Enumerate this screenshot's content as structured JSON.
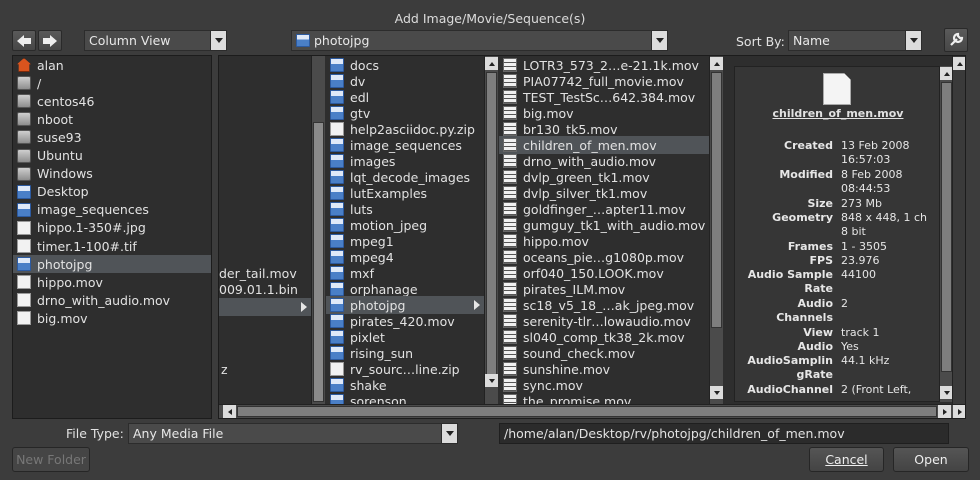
{
  "dialog": {
    "title": "Add Image/Movie/Sequence(s)"
  },
  "toolbar": {
    "view_mode": "Column View",
    "location": "photojpg",
    "sort_label": "Sort By:",
    "sort_value": "Name"
  },
  "places": [
    {
      "label": "alan",
      "icon": "home-icon"
    },
    {
      "label": "/",
      "icon": "drive-icon"
    },
    {
      "label": "centos46",
      "icon": "drive-icon"
    },
    {
      "label": "nboot",
      "icon": "drive-icon"
    },
    {
      "label": "suse93",
      "icon": "drive-icon"
    },
    {
      "label": "Ubuntu",
      "icon": "drive-icon"
    },
    {
      "label": "Windows",
      "icon": "drive-icon"
    },
    {
      "label": "Desktop",
      "icon": "folder-icon"
    },
    {
      "label": "image_sequences",
      "icon": "folder-icon"
    },
    {
      "label": "hippo.1-350#.jpg",
      "icon": "document-icon"
    },
    {
      "label": "timer.1-100#.tif",
      "icon": "document-icon"
    },
    {
      "label": "photojpg",
      "icon": "folder-icon",
      "selected": true
    },
    {
      "label": "hippo.mov",
      "icon": "document-icon"
    },
    {
      "label": "drno_with_audio.mov",
      "icon": "document-icon"
    },
    {
      "label": "big.mov",
      "icon": "document-icon"
    }
  ],
  "column1": {
    "partial_items": [
      "der_tail.mov",
      "009.01.1.bin",
      "z"
    ]
  },
  "column2": [
    {
      "label": "docs",
      "icon": "folder-icon"
    },
    {
      "label": "dv",
      "icon": "folder-icon"
    },
    {
      "label": "edl",
      "icon": "folder-icon"
    },
    {
      "label": "gtv",
      "icon": "folder-icon"
    },
    {
      "label": "help2asciidoc.py.zip",
      "icon": "document-icon"
    },
    {
      "label": "image_sequences",
      "icon": "folder-icon"
    },
    {
      "label": "images",
      "icon": "folder-icon"
    },
    {
      "label": "lqt_decode_images",
      "icon": "folder-icon"
    },
    {
      "label": "lutExamples",
      "icon": "folder-icon"
    },
    {
      "label": "luts",
      "icon": "folder-icon"
    },
    {
      "label": "motion_jpeg",
      "icon": "folder-icon"
    },
    {
      "label": "mpeg1",
      "icon": "folder-icon"
    },
    {
      "label": "mpeg4",
      "icon": "folder-icon"
    },
    {
      "label": "mxf",
      "icon": "folder-icon"
    },
    {
      "label": "orphanage",
      "icon": "folder-icon"
    },
    {
      "label": "photojpg",
      "icon": "folder-icon",
      "selected": true
    },
    {
      "label": "pirates_420.mov",
      "icon": "folder-icon"
    },
    {
      "label": "pixlet",
      "icon": "folder-icon"
    },
    {
      "label": "rising_sun",
      "icon": "folder-icon"
    },
    {
      "label": "rv_sourc…line.zip",
      "icon": "document-icon"
    },
    {
      "label": "shake",
      "icon": "folder-icon"
    },
    {
      "label": "sorenson",
      "icon": "folder-icon"
    }
  ],
  "column3": [
    {
      "label": "LOTR3_573_2…e-21.1k.mov"
    },
    {
      "label": "PIA07742_full_movie.mov"
    },
    {
      "label": "TEST_TestSc…642.384.mov"
    },
    {
      "label": "big.mov"
    },
    {
      "label": "br130_tk5.mov"
    },
    {
      "label": "children_of_men.mov",
      "selected": true
    },
    {
      "label": "drno_with_audio.mov"
    },
    {
      "label": "dvlp_green_tk1.mov"
    },
    {
      "label": "dvlp_silver_tk1.mov"
    },
    {
      "label": "goldfinger_…apter11.mov"
    },
    {
      "label": "gumguy_tk1_with_audio.mov"
    },
    {
      "label": "hippo.mov"
    },
    {
      "label": "oceans_pie…g1080p.mov"
    },
    {
      "label": "orf040_150.LOOK.mov"
    },
    {
      "label": "pirates_ILM.mov"
    },
    {
      "label": "sc18_v5_18_…ak_jpeg.mov"
    },
    {
      "label": "serenity-tlr…lowaudio.mov"
    },
    {
      "label": "sl040_comp_tk38_2k.mov"
    },
    {
      "label": "sound_check.mov"
    },
    {
      "label": "sunshine.mov"
    },
    {
      "label": "sync.mov"
    },
    {
      "label": "the_promise.mov"
    }
  ],
  "preview": {
    "filename": "children_of_men.mov",
    "fields": [
      {
        "key": "Created",
        "value": "13 Feb 2008\n16:57:03"
      },
      {
        "key": "Modified",
        "value": "8 Feb 2008\n08:44:53"
      },
      {
        "key": "Size",
        "value": "273 Mb"
      },
      {
        "key": "Geometry",
        "value": "848 x 448, 1 ch\n8 bit"
      },
      {
        "key": "Frames",
        "value": "1 - 3505"
      },
      {
        "key": "FPS",
        "value": "23.976"
      },
      {
        "key": "Audio Sample\nRate",
        "value": "44100"
      },
      {
        "key": "Audio\nChannels",
        "value": "2"
      },
      {
        "key": "View",
        "value": "track 1"
      },
      {
        "key": "Audio",
        "value": "Yes"
      },
      {
        "key": "AudioSamplin\ngRate",
        "value": "44.1 kHz"
      },
      {
        "key": "AudioChannel",
        "value": "2 (Front Left,"
      }
    ]
  },
  "footer": {
    "file_type_label": "File Type:",
    "file_type_value": "Any Media File",
    "path": "/home/alan/Desktop/rv/photojpg/children_of_men.mov",
    "new_folder": "New Folder",
    "cancel": "Cancel",
    "open": "Open"
  }
}
